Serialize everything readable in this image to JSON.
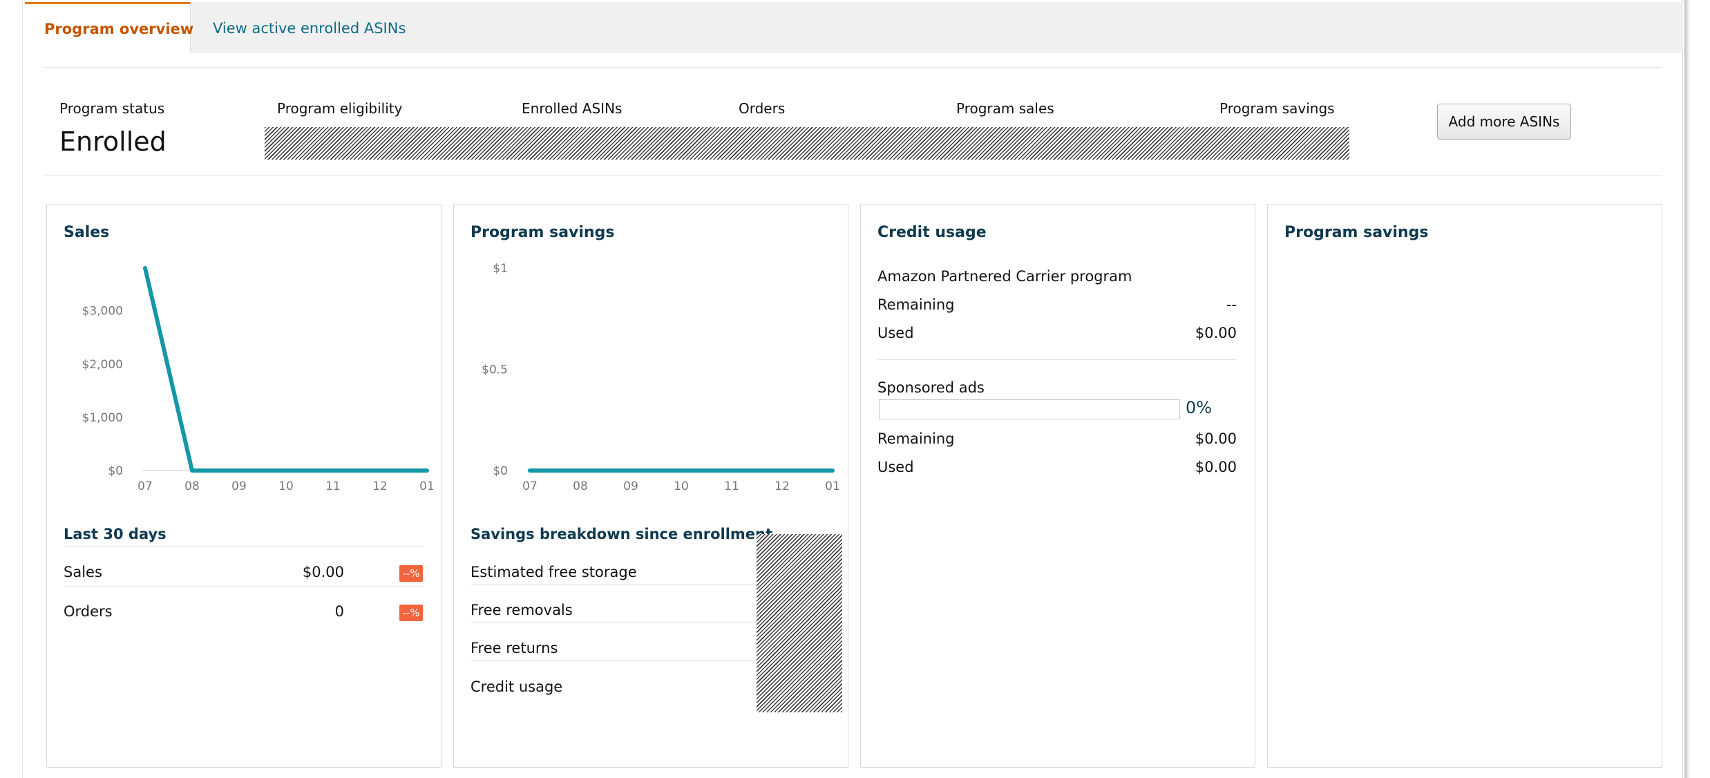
{
  "tabs": [
    {
      "label": "Program overview",
      "active": true
    },
    {
      "label": "View active enrolled ASINs",
      "active": false
    }
  ],
  "summary": {
    "labels": [
      "Program status",
      "Program eligibility",
      "Enrolled ASINs",
      "Orders",
      "Program sales",
      "Program savings"
    ],
    "status_value": "Enrolled",
    "add_button": "Add more ASINs"
  },
  "sales_card": {
    "title": "Sales",
    "period_title": "Last 30 days",
    "rows": [
      {
        "label": "Sales",
        "value": "$0.00",
        "badge": "--%"
      },
      {
        "label": "Orders",
        "value": "0",
        "badge": "--%"
      }
    ]
  },
  "savings_card": {
    "title": "Program savings",
    "breakdown_title": "Savings breakdown since enrollment",
    "items": [
      "Estimated free storage",
      "Free removals",
      "Free returns",
      "Credit usage"
    ]
  },
  "credit_card": {
    "title": "Credit usage",
    "carrier_program": "Amazon Partnered Carrier program",
    "carrier_rows": [
      {
        "label": "Remaining",
        "value": "--"
      },
      {
        "label": "Used",
        "value": "$0.00"
      }
    ],
    "sponsored_title": "Sponsored ads",
    "sponsored_pct_text": "0%",
    "sponsored_fraction": 0,
    "sponsored_rows": [
      {
        "label": "Remaining",
        "value": "$0.00"
      },
      {
        "label": "Used",
        "value": "$0.00"
      }
    ]
  },
  "savings_card_2": {
    "title": "Program savings"
  },
  "colors": {
    "accent": "#c45500",
    "link": "#0b6a86",
    "line": "#1597a9",
    "badge": "#f2643c"
  },
  "chart_data": [
    {
      "type": "line",
      "x": [
        "07",
        "08",
        "09",
        "10",
        "11",
        "12",
        "01"
      ],
      "y": [
        3800,
        0,
        0,
        0,
        0,
        0,
        0
      ],
      "yticks": [
        0,
        1000,
        2000,
        3000
      ],
      "ytick_labels": [
        "$0",
        "$1,000",
        "$2,000",
        "$3,000"
      ],
      "ylim": [
        0,
        3800
      ]
    },
    {
      "type": "line",
      "x": [
        "07",
        "08",
        "09",
        "10",
        "11",
        "12",
        "01"
      ],
      "y": [
        0,
        0,
        0,
        0,
        0,
        0,
        0
      ],
      "yticks": [
        0,
        0.5,
        1
      ],
      "ytick_labels": [
        "$0",
        "$0.5",
        "$1"
      ],
      "ylim": [
        0,
        1
      ]
    }
  ]
}
